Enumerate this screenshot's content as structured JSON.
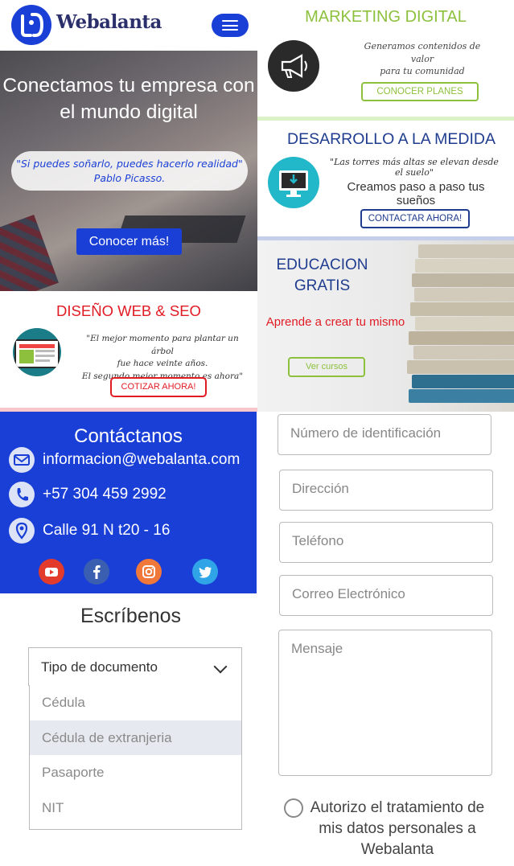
{
  "brand": {
    "name": "Webalanta",
    "primary_color": "#1a3fd6"
  },
  "header": {
    "menu_icon": "hamburger-icon"
  },
  "hero": {
    "title": "Conectamos tu empresa con el mundo digital",
    "quote_line1": "\"Si puedes soñarlo, puedes hacerlo realidad\"",
    "quote_line2": "Pablo Picasso.",
    "button": "Conocer más!"
  },
  "web_seo": {
    "title": "DISEÑO WEB & SEO",
    "quote_line1": "\"El mejor momento para plantar un árbol",
    "quote_line2": "fue hace veinte años.",
    "quote_line3": "El segundo mejor momento es ahora\"",
    "button": "COTIZAR AHORA!",
    "accent": "#e11b24"
  },
  "marketing": {
    "title": "MARKETING DIGITAL",
    "text_line1": "Generamos contenidos de valor",
    "text_line2": "para tu comunidad",
    "button": "CONOCER PLANES",
    "accent": "#8dc13d"
  },
  "development": {
    "title": "DESARROLLO A LA MEDIDA",
    "quote": "\"Las torres más altas se elevan desde el suelo\"",
    "text": "Creamos paso a paso tus sueños",
    "button": "CONTACTAR AHORA!",
    "accent": "#1f3c8f"
  },
  "education": {
    "title_line1": "EDUCACION",
    "title_line2": "GRATIS",
    "subtitle": "Aprende a crear tu mismo",
    "button": "Ver cursos"
  },
  "contact": {
    "title": "Contáctanos",
    "email": "informacion@webalanta.com",
    "phone": "+57 304 459 2992",
    "address": "Calle 91 N t20 - 16",
    "social": [
      "youtube-icon",
      "facebook-icon",
      "instagram-icon",
      "twitter-icon"
    ]
  },
  "form": {
    "title": "Escríbenos",
    "doc_type_selected": "Tipo de documento",
    "doc_type_options": [
      "Cédula",
      "Cédula de extranjeria",
      "Pasaporte",
      "NIT"
    ],
    "id_placeholder": "Número de identificación",
    "address_placeholder": "Dirección",
    "phone_placeholder": "Teléfono",
    "email_placeholder": "Correo Electrónico",
    "message_placeholder": "Mensaje",
    "consent": "Autorizo el tratamiento de mis datos personales a Webalanta"
  }
}
